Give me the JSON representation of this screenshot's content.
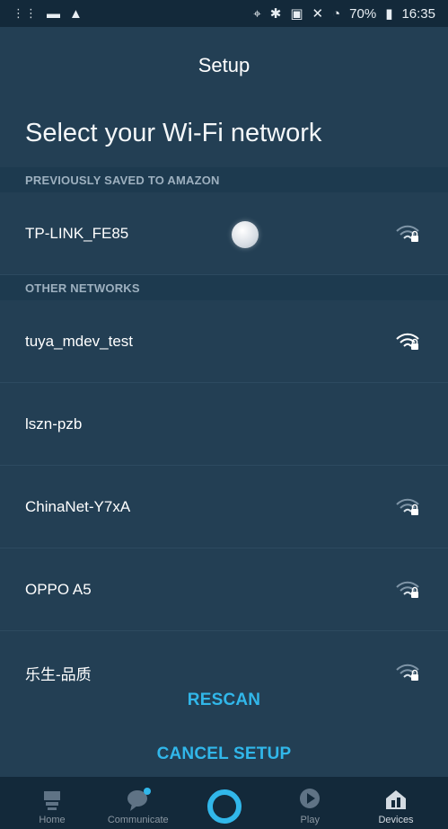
{
  "status_bar": {
    "left_icons": [
      "signal-dots-icon",
      "video-icon",
      "warning-icon"
    ],
    "right_text": "70%",
    "time": "16:35"
  },
  "header": {
    "title": "Setup"
  },
  "page": {
    "heading": "Select your Wi-Fi network"
  },
  "sections": [
    {
      "label": "PREVIOUSLY SAVED TO AMAZON",
      "networks": [
        {
          "name": "TP-LINK_FE85",
          "icon": "wifi-lock-icon",
          "signal_strength": "medium"
        }
      ]
    },
    {
      "label": "OTHER NETWORKS",
      "networks": [
        {
          "name": "tuya_mdev_test",
          "icon": "wifi-lock-icon",
          "signal_strength": "strong"
        },
        {
          "name": "lszn-pzb",
          "icon": "",
          "signal_strength": ""
        },
        {
          "name": "ChinaNet-Y7xA",
          "icon": "wifi-lock-icon",
          "signal_strength": "medium"
        },
        {
          "name": "OPPO A5",
          "icon": "wifi-lock-icon",
          "signal_strength": "medium"
        },
        {
          "name": "乐生-品质",
          "icon": "wifi-lock-icon",
          "signal_strength": "medium"
        }
      ]
    }
  ],
  "actions": {
    "rescan": "RESCAN",
    "cancel_setup": "CANCEL SETUP"
  },
  "bottom_nav": [
    {
      "label": "Home",
      "icon": "home-icon",
      "active": false
    },
    {
      "label": "Communicate",
      "icon": "chat-icon",
      "active": false
    },
    {
      "label": "",
      "icon": "alexa-ring-icon",
      "active": false
    },
    {
      "label": "Play",
      "icon": "play-icon",
      "active": false
    },
    {
      "label": "Devices",
      "icon": "devices-icon",
      "active": true
    }
  ],
  "colors": {
    "background": "#233f54",
    "accent": "#31b7ea",
    "status_bar": "#13293a"
  }
}
